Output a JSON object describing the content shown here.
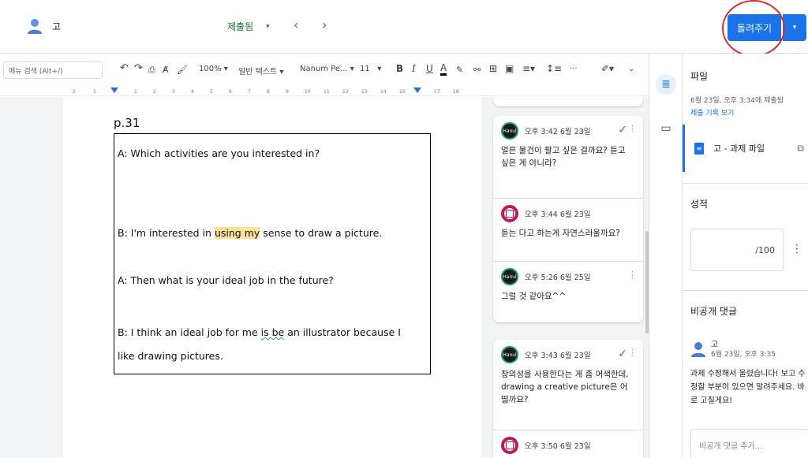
{
  "header": {
    "student_name": "고",
    "status_label": "제출됨",
    "status_caret": "▾",
    "prev_arrow": "‹",
    "next_arrow": "›",
    "return_label": "돌려주기",
    "return_caret": "▾"
  },
  "toolbar": {
    "menu_search_placeholder": "메뉴 검색 (Alt+/)",
    "zoom": "100%",
    "zoom_caret": "▾",
    "style": "일반 텍스트",
    "style_caret": "▾",
    "font": "Nanum Pe...",
    "font_caret": "▾",
    "font_size": "11",
    "size_caret": "▾",
    "bold": "B",
    "italic": "I",
    "underline": "U",
    "text_color": "A",
    "more": "···"
  },
  "ruler": {
    "ticks": [
      "2",
      "1",
      "1",
      "1",
      "2",
      "3",
      "4",
      "5",
      "6",
      "7",
      "8",
      "9",
      "10",
      "11",
      "12",
      "13",
      "14",
      "15",
      "16",
      "17",
      "18"
    ]
  },
  "document": {
    "page_label": "p.31",
    "line1": "A: Which activities are you interested in?",
    "line2_pre": "B: I'm interested in ",
    "line2_hl": "using my",
    "line2_post": " sense to draw a picture.",
    "line3": "A: Then what is your ideal job in the future?",
    "line4_pre": "B: I think an ideal job for me ",
    "line4_sq": "is be",
    "line4_post": " an illustrator because I",
    "line5": "like drawing pictures."
  },
  "comments": {
    "thread1": [
      {
        "avatar": "Hanul",
        "time": "오후 3:42 6월 23일",
        "body": "얼른 물건이 팔고 싶은 걸까요? 듣고 싶은 게 아니라?"
      },
      {
        "avatar": "",
        "time": "오후 3:44 6월 23일",
        "body": "듣는 다고 하는게 자연스러울까요?"
      },
      {
        "avatar": "Hanul",
        "time": "오후 5:26 6월 25일",
        "body": "그럴 것 같아요^^"
      }
    ],
    "thread2": [
      {
        "avatar": "Hanul",
        "time": "오후 3:43 6월 23일",
        "body": "창의성을 사용한다는 게 좀 어색한데, drawing a creative picture은 어떨까요?"
      },
      {
        "avatar": "",
        "time": "오후 3:50 6월 23일",
        "body": ""
      }
    ],
    "resolve_icon": "✓",
    "more_icon": "⋮"
  },
  "panel": {
    "files_title": "파일",
    "submitted_time": "6월 23일, 오후 3:34에 제출됨",
    "history_link": "제출 기록 보기",
    "file_name": "고     - 과제 파일",
    "grade_title": "성적",
    "grade_out_of": "/100",
    "grade_more": "⋮",
    "private_title": "비공개 댓글",
    "pc_name": "고",
    "pc_time": "6월 23일, 오후 3:35",
    "pc_body": "과제 수정해서 올렸습니다! 보고 수정할 부분이 있으면 알려주세요. 바로 고칠게요!",
    "pc_placeholder": "비공개 댓글 추가..."
  },
  "colors": {
    "accent": "#1a73e8",
    "submitted": "#137333",
    "annotation": "#d93025",
    "highlight": "#fde293"
  }
}
